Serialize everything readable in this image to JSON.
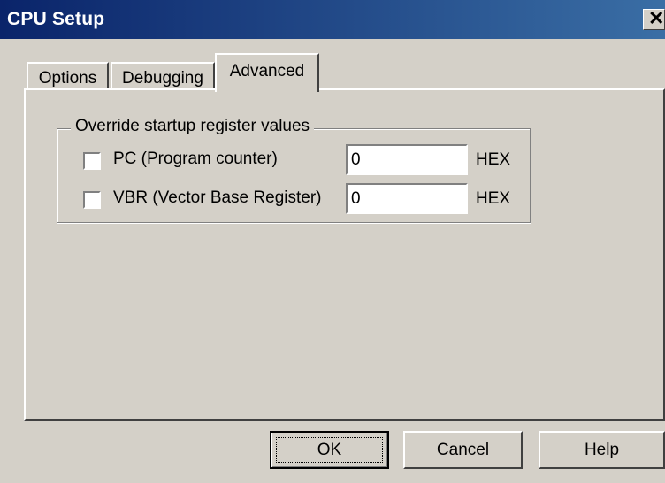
{
  "window": {
    "title": "CPU Setup",
    "close_glyph": "✕"
  },
  "tabs": [
    {
      "label": "Options",
      "active": false
    },
    {
      "label": "Debugging",
      "active": false
    },
    {
      "label": "Advanced",
      "active": true
    }
  ],
  "advanced": {
    "group_label": "Override startup register values",
    "rows": [
      {
        "label": "PC (Program counter)",
        "checked": false,
        "value": "0",
        "unit": "HEX"
      },
      {
        "label": "VBR (Vector Base Register)",
        "checked": false,
        "value": "0",
        "unit": "HEX"
      }
    ]
  },
  "buttons": {
    "ok": "OK",
    "cancel": "Cancel",
    "help": "Help"
  }
}
